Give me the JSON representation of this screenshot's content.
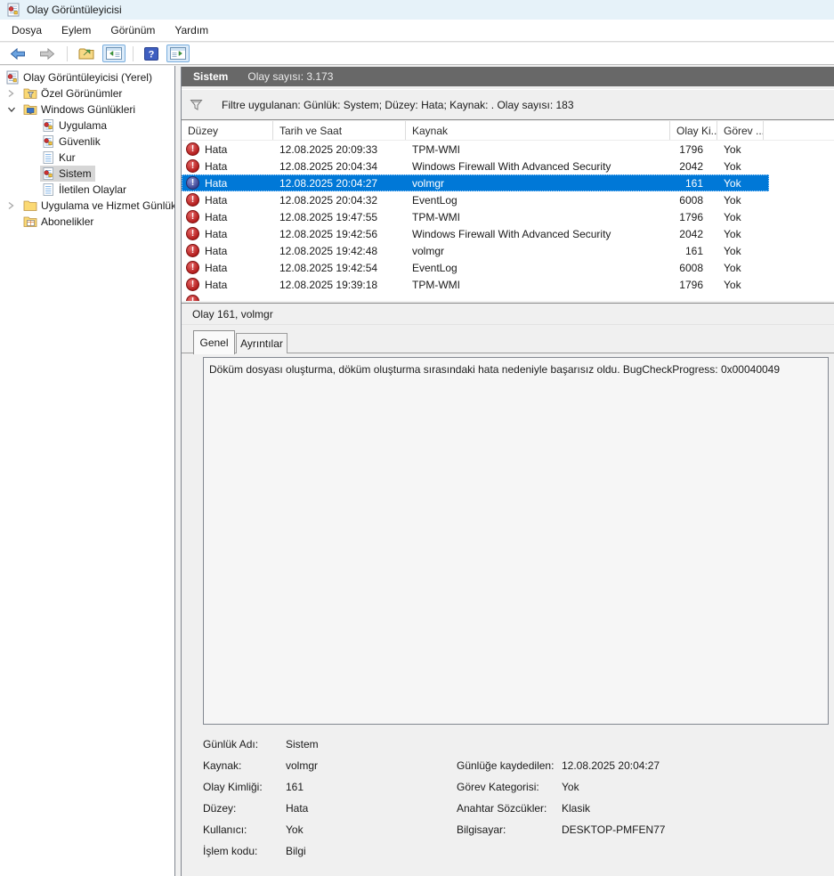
{
  "window": {
    "title": "Olay Görüntüleyicisi"
  },
  "menu": [
    "Dosya",
    "Eylem",
    "Görünüm",
    "Yardım"
  ],
  "toolbar": [
    {
      "name": "back-button",
      "icon": "arrow-back-icon",
      "toggled": false
    },
    {
      "name": "forward-button",
      "icon": "arrow-forward-icon",
      "toggled": false
    },
    {
      "name": "export-button",
      "icon": "export-folder-icon",
      "toggled": false
    },
    {
      "name": "show-console-tree-button",
      "icon": "console-tree-icon",
      "toggled": true
    },
    {
      "name": "help-button",
      "icon": "help-icon",
      "toggled": false
    },
    {
      "name": "show-action-pane-button",
      "icon": "action-pane-icon",
      "toggled": true
    }
  ],
  "tree": {
    "items": [
      {
        "label": "Olay Görüntüleyicisi (Yerel)",
        "level": 0,
        "chevron": "none",
        "icon": "event-viewer-root-icon",
        "selected": false
      },
      {
        "label": "Özel Görünümler",
        "level": 1,
        "chevron": "collapsed",
        "icon": "filter-folder-icon",
        "selected": false
      },
      {
        "label": "Windows Günlükleri",
        "level": 1,
        "chevron": "expanded",
        "icon": "monitor-folder-icon",
        "selected": false
      },
      {
        "label": "Uygulama",
        "level": 2,
        "chevron": "none",
        "icon": "event-log-icon",
        "selected": false
      },
      {
        "label": "Güvenlik",
        "level": 2,
        "chevron": "none",
        "icon": "event-log-icon",
        "selected": false
      },
      {
        "label": "Kur",
        "level": 2,
        "chevron": "none",
        "icon": "plain-log-icon",
        "selected": false
      },
      {
        "label": "Sistem",
        "level": 2,
        "chevron": "none",
        "icon": "event-log-icon",
        "selected": true
      },
      {
        "label": "İletilen Olaylar",
        "level": 2,
        "chevron": "none",
        "icon": "plain-log-icon",
        "selected": false
      },
      {
        "label": "Uygulama ve Hizmet Günlük",
        "level": 1,
        "chevron": "collapsed",
        "icon": "folder-icon",
        "selected": false
      },
      {
        "label": "Abonelikler",
        "level": 1,
        "chevron": "none",
        "icon": "subscriptions-folder-icon",
        "selected": false
      }
    ]
  },
  "main": {
    "header": {
      "title": "Sistem",
      "count": "Olay sayısı: 3.173"
    },
    "filter": {
      "text": "Filtre uygulanan: Günlük: System; Düzey: Hata; Kaynak: . Olay sayısı: 183"
    },
    "table": {
      "columns": [
        "Düzey",
        "Tarih ve Saat",
        "Kaynak",
        "Olay Ki...",
        "Görev ..."
      ],
      "rows": [
        {
          "level": "Hata",
          "date": "12.08.2025 20:09:33",
          "source": "TPM-WMI",
          "event_id": "1796",
          "task": "Yok",
          "selected": false
        },
        {
          "level": "Hata",
          "date": "12.08.2025 20:04:34",
          "source": "Windows Firewall With Advanced Security",
          "event_id": "2042",
          "task": "Yok",
          "selected": false
        },
        {
          "level": "Hata",
          "date": "12.08.2025 20:04:27",
          "source": "volmgr",
          "event_id": "161",
          "task": "Yok",
          "selected": true
        },
        {
          "level": "Hata",
          "date": "12.08.2025 20:04:32",
          "source": "EventLog",
          "event_id": "6008",
          "task": "Yok",
          "selected": false
        },
        {
          "level": "Hata",
          "date": "12.08.2025 19:47:55",
          "source": "TPM-WMI",
          "event_id": "1796",
          "task": "Yok",
          "selected": false
        },
        {
          "level": "Hata",
          "date": "12.08.2025 19:42:56",
          "source": "Windows Firewall With Advanced Security",
          "event_id": "2042",
          "task": "Yok",
          "selected": false
        },
        {
          "level": "Hata",
          "date": "12.08.2025 19:42:48",
          "source": "volmgr",
          "event_id": "161",
          "task": "Yok",
          "selected": false
        },
        {
          "level": "Hata",
          "date": "12.08.2025 19:42:54",
          "source": "EventLog",
          "event_id": "6008",
          "task": "Yok",
          "selected": false
        },
        {
          "level": "Hata",
          "date": "12.08.2025 19:39:18",
          "source": "TPM-WMI",
          "event_id": "1796",
          "task": "Yok",
          "selected": false
        }
      ]
    },
    "detail": {
      "title": "Olay 161, volmgr",
      "tabs": [
        {
          "label": "Genel",
          "active": true
        },
        {
          "label": "Ayrıntılar",
          "active": false
        }
      ],
      "description": "Döküm dosyası oluşturma, döküm oluşturma sırasındaki hata nedeniyle başarısız oldu. BugCheckProgress: 0x00040049",
      "fields_left": [
        {
          "label": "Günlük Adı:",
          "value": "Sistem"
        },
        {
          "label": "Kaynak:",
          "value": "volmgr"
        },
        {
          "label": "Olay Kimliği:",
          "value": "161"
        },
        {
          "label": "Düzey:",
          "value": "Hata"
        },
        {
          "label": "Kullanıcı:",
          "value": "Yok"
        },
        {
          "label": "İşlem kodu:",
          "value": "Bilgi"
        }
      ],
      "fields_right": [
        {
          "label": "Günlüğe kaydedilen:",
          "value": "12.08.2025 20:04:27"
        },
        {
          "label": "Görev Kategorisi:",
          "value": "Yok"
        },
        {
          "label": "Anahtar Sözcükler:",
          "value": "Klasik"
        },
        {
          "label": "Bilgisayar:",
          "value": "DESKTOP-PMFEN77"
        }
      ]
    }
  },
  "colors": {
    "selection": "#0078d7",
    "header_bar": "#686868",
    "error_icon": "#b01818",
    "titlebar": "#e6f2f9"
  }
}
